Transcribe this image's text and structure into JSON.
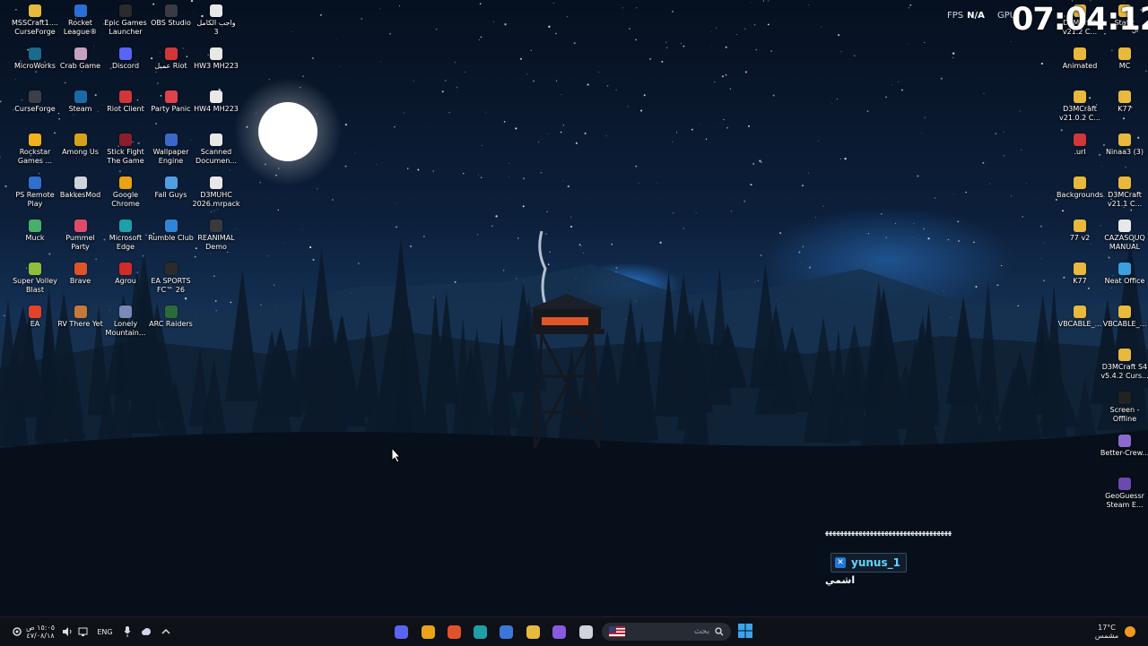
{
  "overlay": {
    "fps_label": "FPS",
    "fps_value": "N/A",
    "gpu_label": "GPU",
    "clock": "07:04:12",
    "corner_text": "ال"
  },
  "desktop_left": [
    {
      "label": "MSSCraft1....\nCurseForge",
      "icon": "folder-icon",
      "color": "#e8b93c"
    },
    {
      "label": "Rocket\nLeague®",
      "icon": "rocket-league-icon",
      "color": "#2a6fd6"
    },
    {
      "label": "Epic Games\nLauncher",
      "icon": "epic-games-icon",
      "color": "#2b2b2b"
    },
    {
      "label": "OBS Studio",
      "icon": "obs-icon",
      "color": "#3a3a44"
    },
    {
      "label": "واجب الكامل\n3",
      "icon": "document-icon",
      "color": "#e8e8e8"
    },
    {
      "label": "MicroWorks",
      "icon": "microworks-icon",
      "color": "#1a6b8c"
    },
    {
      "label": "Crab Game",
      "icon": "crab-game-icon",
      "color": "#c8a0c0"
    },
    {
      "label": "Discord",
      "icon": "discord-icon",
      "color": "#5865f2"
    },
    {
      "label": "عميل Riot",
      "icon": "riot-client-icon",
      "color": "#d13639"
    },
    {
      "label": "HW3 MH223",
      "icon": "document-icon",
      "color": "#e8e8e8"
    },
    {
      "label": "CurseForge",
      "icon": "curseforge-icon",
      "color": "#3a3f48"
    },
    {
      "label": "Steam",
      "icon": "steam-icon",
      "color": "#1b6aa5"
    },
    {
      "label": "Riot Client",
      "icon": "riot-client-icon",
      "color": "#d13639"
    },
    {
      "label": "Party Panic",
      "icon": "party-panic-icon",
      "color": "#e0424a"
    },
    {
      "label": "HW4 MH223",
      "icon": "document-icon",
      "color": "#e8e8e8"
    },
    {
      "label": "Rockstar\nGames ...",
      "icon": "rockstar-icon",
      "color": "#f2b21b"
    },
    {
      "label": "Among Us",
      "icon": "among-us-icon",
      "color": "#d6a21c"
    },
    {
      "label": "Stick Fight\nThe Game",
      "icon": "stick-fight-icon",
      "color": "#8a1f2b"
    },
    {
      "label": "Wallpaper\nEngine",
      "icon": "wallpaper-engine-icon",
      "color": "#3a68c8"
    },
    {
      "label": "Scanned\nDocumen...",
      "icon": "document-icon",
      "color": "#e8e8e8"
    },
    {
      "label": "PS Remote\nPlay",
      "icon": "ps-remote-play-icon",
      "color": "#2f6fd0"
    },
    {
      "label": "BakkesMod",
      "icon": "bakkesmod-icon",
      "color": "#cfd4dc"
    },
    {
      "label": "Google\nChrome",
      "icon": "chrome-icon",
      "color": "#e8a316"
    },
    {
      "label": "Fall Guys",
      "icon": "fall-guys-icon",
      "color": "#4ea0e0"
    },
    {
      "label": "D3MUHC\n2026.mrpack",
      "icon": "file-icon",
      "color": "#e8e8e8"
    },
    {
      "label": "Muck",
      "icon": "muck-icon",
      "color": "#46b06a"
    },
    {
      "label": "Pummel\nParty",
      "icon": "pummel-party-icon",
      "color": "#e04a6a"
    },
    {
      "label": "Microsoft\nEdge",
      "icon": "edge-icon",
      "color": "#1ea0a8"
    },
    {
      "label": "Rumble Club",
      "icon": "rumble-club-icon",
      "color": "#2f86d8"
    },
    {
      "label": "REANIMAL\nDemo",
      "icon": "reanimal-icon",
      "color": "#3a3a3a"
    },
    {
      "label": "Super Volley\nBlast",
      "icon": "super-volley-icon",
      "color": "#8fbf3a"
    },
    {
      "label": "Brave",
      "icon": "brave-icon",
      "color": "#e0532a"
    },
    {
      "label": "Agrou",
      "icon": "agrou-icon",
      "color": "#d12c2c"
    },
    {
      "label": "EA SPORTS\nFC™ 26",
      "icon": "ea-fc-icon",
      "color": "#2b2b2b"
    },
    {
      "label": "",
      "icon": "",
      "color": ""
    },
    {
      "label": "EA",
      "icon": "ea-icon",
      "color": "#e2432a"
    },
    {
      "label": "RV There Yet",
      "icon": "rv-there-yet-icon",
      "color": "#c67a3a"
    },
    {
      "label": "Lonely\nMountain...",
      "icon": "lonely-mountains-icon",
      "color": "#7a8ab8"
    },
    {
      "label": "ARC Raiders",
      "icon": "arc-raiders-icon",
      "color": "#2b6a3a"
    }
  ],
  "desktop_right": [
    {
      "label": "D3MCraft\nv21.2 C...",
      "icon": "folder-icon",
      "color": "#e8b93c"
    },
    {
      "label": "Static",
      "icon": "folder-icon",
      "color": "#e8b93c"
    },
    {
      "label": "Animated",
      "icon": "folder-icon",
      "color": "#e8b93c"
    },
    {
      "label": "MC",
      "icon": "folder-icon",
      "color": "#e8b93c"
    },
    {
      "label": "D3MCraft\nv21.0.2 C...",
      "icon": "folder-icon",
      "color": "#e8b93c"
    },
    {
      "label": "K77",
      "icon": "folder-icon",
      "color": "#e8b93c"
    },
    {
      "label": ".url",
      "icon": "url-icon",
      "color": "#d13639"
    },
    {
      "label": "Ninaa3 (3)",
      "icon": "folder-icon",
      "color": "#e8b93c"
    },
    {
      "label": "Backgrounds",
      "icon": "folder-icon",
      "color": "#e8b93c"
    },
    {
      "label": "D3MCraft\nv21.1 C...",
      "icon": "folder-icon",
      "color": "#e8b93c"
    },
    {
      "label": "77 v2",
      "icon": "folder-icon",
      "color": "#e8b93c"
    },
    {
      "label": "CAZASOUQ\nMANUAL",
      "icon": "document-icon",
      "color": "#e8e8e8"
    },
    {
      "label": "K77",
      "icon": "folder-icon",
      "color": "#e8b93c"
    },
    {
      "label": "Neat Office",
      "icon": "neat-office-icon",
      "color": "#3aa0e0"
    },
    {
      "label": "VBCABLE_...",
      "icon": "folder-icon",
      "color": "#e8b93c"
    },
    {
      "label": "VBCABLE_...",
      "icon": "folder-icon",
      "color": "#e8b93c"
    },
    {
      "label": "",
      "icon": "",
      "color": ""
    },
    {
      "label": "D3MCraft S4\nv5.4.2 Curs...",
      "icon": "folder-icon",
      "color": "#e8b93c"
    },
    {
      "label": "",
      "icon": "",
      "color": ""
    },
    {
      "label": "Screen -\nOffline",
      "icon": "screen-icon",
      "color": "#222"
    },
    {
      "label": "",
      "icon": "",
      "color": ""
    },
    {
      "label": "Better-Crew...",
      "icon": "better-crewlink-icon",
      "color": "#8a6ad0"
    },
    {
      "label": "",
      "icon": "",
      "color": ""
    },
    {
      "label": "GeoGuessr\nSteam E...",
      "icon": "geoguessr-icon",
      "color": "#6a4ab0"
    }
  ],
  "chat": {
    "wave_text": "ﻬﻬﻬﻬﻬﻬﻬﻬﻬﻬﻬﻬﻬﻬﻬﻬﻬﻬﻬﻬﻬﻬﻬﻬﻬﻬﻬﻬﻬﻬﻬﻬﻬﻬ",
    "username": "yunus_1",
    "message": "اشمي"
  },
  "taskbar": {
    "search_placeholder": "بحث",
    "apps": [
      {
        "icon": "discord-icon",
        "color": "#5865f2"
      },
      {
        "icon": "chrome-icon",
        "color": "#e8a316"
      },
      {
        "icon": "brave-icon",
        "color": "#e0532a"
      },
      {
        "icon": "edge-icon",
        "color": "#1ea0a8"
      },
      {
        "icon": "store-icon",
        "color": "#3a78d8"
      },
      {
        "icon": "file-explorer-icon",
        "color": "#e8b93c"
      },
      {
        "icon": "copilot-icon",
        "color": "#8a5ae0"
      },
      {
        "icon": "task-view-icon",
        "color": "#cfd4dc"
      }
    ],
    "tray_time": "١٥:٠٥ ص",
    "tray_date": "٤٧/٠٨/١٨",
    "language": "ENG",
    "weather_temp": "17°C",
    "weather_desc": "مشمس"
  }
}
